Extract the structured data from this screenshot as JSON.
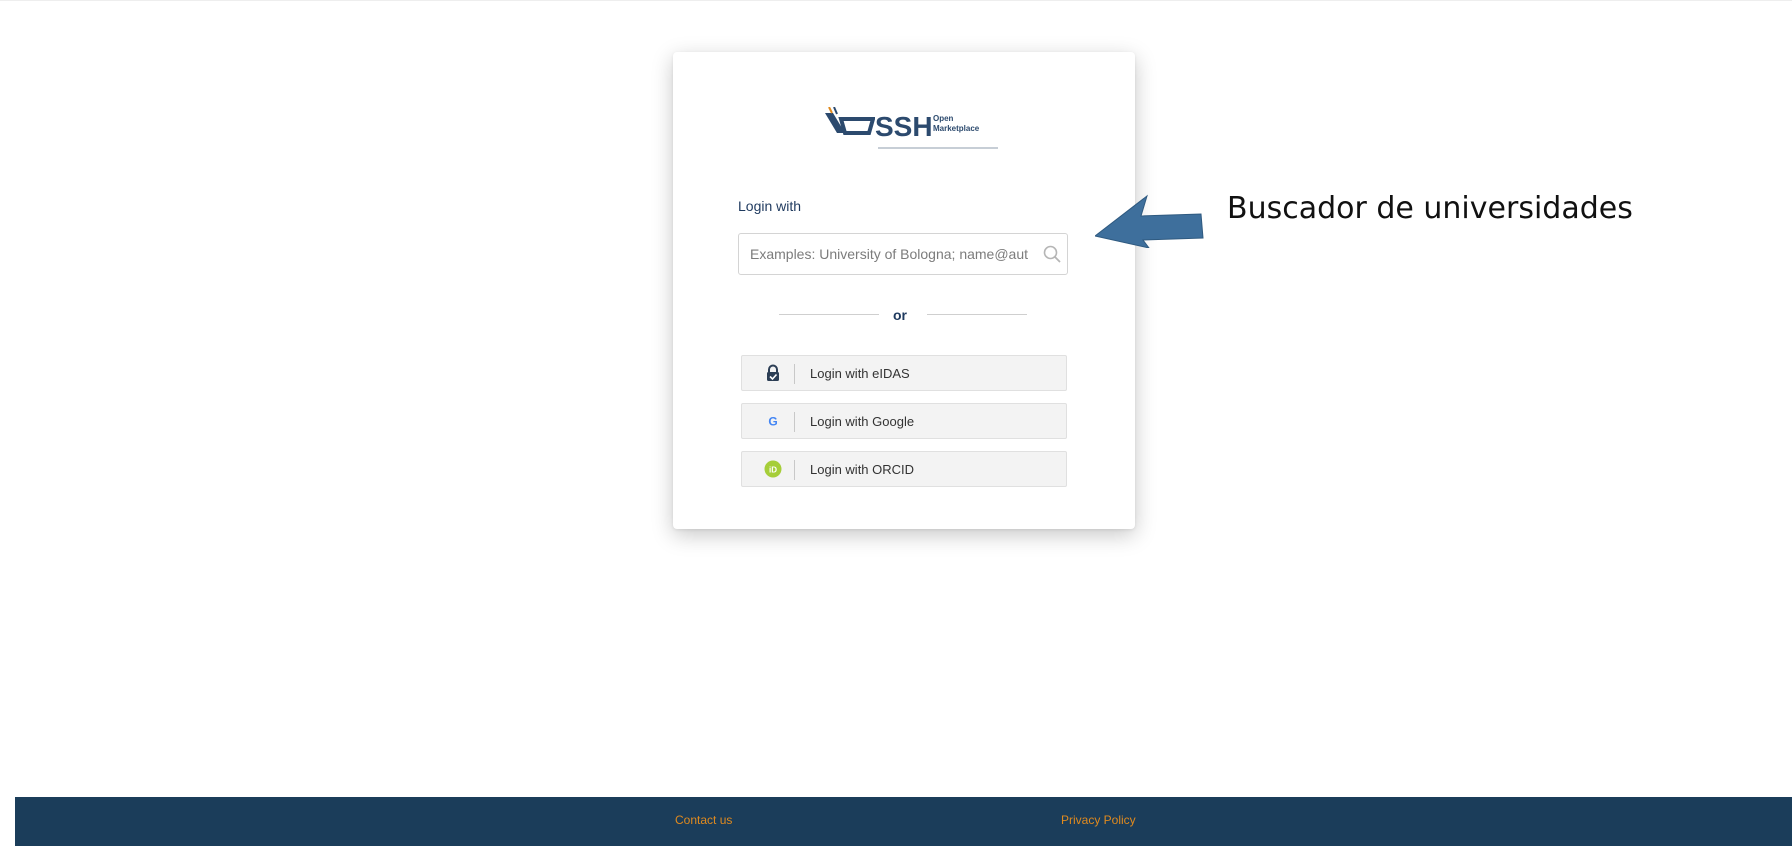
{
  "logo": {
    "wordmark": "SSH",
    "line1": "Open",
    "line2": "Marketplace"
  },
  "login": {
    "heading": "Login with",
    "search_placeholder": "Examples: University of Bologna; name@aut",
    "or_label": "or"
  },
  "providers": [
    {
      "label": "Login with eIDAS",
      "icon": "lock-shield-icon"
    },
    {
      "label": "Login with Google",
      "icon": "google-icon"
    },
    {
      "label": "Login with ORCID",
      "icon": "orcid-icon"
    }
  ],
  "footer": {
    "contact": "Contact us",
    "privacy": "Privacy Policy"
  },
  "annotation": {
    "text": "Buscador de universidades"
  },
  "colors": {
    "brand_navy": "#2c4a6e",
    "footer_bg": "#1b3d5a",
    "footer_link": "#e08a1e",
    "orcid_green": "#a6ce39",
    "annotation_arrow": "#3e6f9c"
  }
}
